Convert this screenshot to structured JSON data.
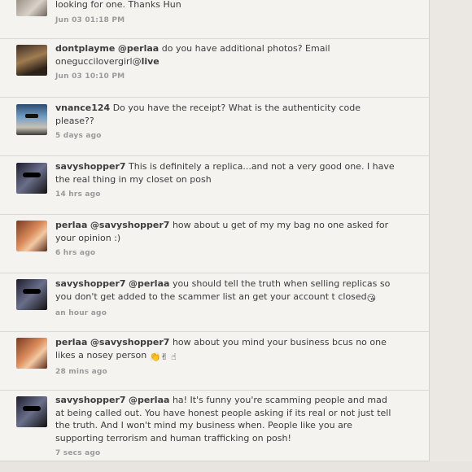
{
  "comments": [
    {
      "username": "",
      "mention": "",
      "text": "looking for one.  Thanks Hun",
      "time": "Jun 03 01:18 PM"
    },
    {
      "username": "dontplayme",
      "mention": "@perlaa",
      "text": "do you have additional photos? Email oneguccilovergirl@",
      "text_bold": "live",
      "time": "Jun 03 10:10 PM"
    },
    {
      "username": "vnance124",
      "mention": "",
      "text": "Do you have the receipt?  What is the authenticity code please??",
      "time": "5 days ago"
    },
    {
      "username": "savyshopper7",
      "mention": "",
      "text": "This is definitely a replica...and not a very good one. I have the real thing in my closet on posh",
      "time": "14 hrs ago"
    },
    {
      "username": "perlaa",
      "mention": "@savyshopper7",
      "text": "how about u get of my my bag no one asked for your opinion :)",
      "time": "6 hrs ago"
    },
    {
      "username": "savyshopper7",
      "mention": "@perlaa",
      "text": "you should tell the truth when selling replicas so you don't get added to the scammer list an get your account t closed",
      "emoji": "😘",
      "time": "an hour ago"
    },
    {
      "username": "perlaa",
      "mention": "@savyshopper7",
      "text": "how about you mind your business bcus no one likes a nosey person",
      "emoji": "👏✌ ☝",
      "time": "28 mins ago"
    },
    {
      "username": "savyshopper7",
      "mention": "@perlaa",
      "text": "ha! It's funny you're scamming people and mad at being called out. You have honest people asking if its real or not just tell the truth. And I won't mind my business when. People like you are supporting terrorism and human trafficking on posh!",
      "time": "7 secs ago"
    }
  ]
}
